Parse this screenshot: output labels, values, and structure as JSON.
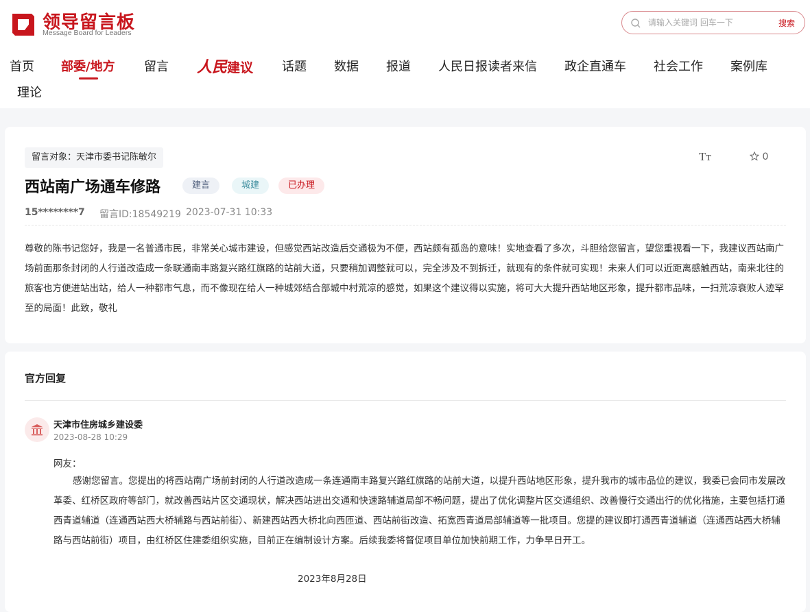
{
  "brand": {
    "title": "领导留言板",
    "subtitle": "Message Board for Leaders",
    "primary_color": "#c8161d"
  },
  "search": {
    "placeholder": "请输入关键词 回车一下",
    "button_label": "搜索",
    "icon": "search-icon"
  },
  "nav": {
    "items": [
      {
        "label": "首页"
      },
      {
        "label": "部委/地方",
        "active": true
      },
      {
        "label": "留言"
      },
      {
        "label_script": "人民",
        "label_rest": "建议"
      },
      {
        "label": "话题"
      },
      {
        "label": "数据"
      },
      {
        "label": "报道"
      },
      {
        "label": "人民日报读者来信"
      },
      {
        "label": "政企直通车"
      },
      {
        "label": "社会工作"
      },
      {
        "label": "案例库"
      },
      {
        "label": "理论"
      }
    ]
  },
  "message": {
    "target": "留言对象：天津市委书记陈敏尔",
    "font_toggle": "Tт",
    "favorite_count": "0",
    "title": "西站南广场通车修路",
    "tags": [
      "建言",
      "城建",
      "已办理"
    ],
    "user": "15********7",
    "message_id": "留言ID:18549219",
    "date": "2023-07-31 10:33",
    "content": "尊敬的陈书记您好，我是一名普通市民，非常关心城市建设，但感觉西站改造后交通极为不便，西站颇有孤岛的意味！实地查看了多次，斗胆给您留言，望您重视看一下，我建议西站南广场前面那条封闭的人行道改造成一条联通南丰路复兴路红旗路的站前大道，只要稍加调整就可以，完全涉及不到拆迁，就现有的条件就可实现！未来人们可以近距离感触西站，南来北往的旅客也方便进站出站，给人一种都市气息，而不像现在给人一种城郊结合部城中村荒凉的感觉，如果这个建议得以实施，将可大大提升西站地区形象，提升都市品味，一扫荒凉衰败人迹罕至的局面！此致，敬礼"
  },
  "reply": {
    "heading": "官方回复",
    "org_name": "天津市住房城乡建设委",
    "date": "2023-08-28 10:29",
    "salutation": "网友：",
    "body": "感谢您留言。您提出的将西站南广场前封闭的人行道改造成一条连通南丰路复兴路红旗路的站前大道，以提升西站地区形象，提升我市的城市品位的建议，我委已会同市发展改革委、红桥区政府等部门，就改善西站片区交通现状，解决西站进出交通和快速路辅道局部不畅问题，提出了优化调整片区交通组织、改善慢行交通出行的优化措施，主要包括打通西青道辅道（连通西站西大桥辅路与西站前街）、新建西站西大桥北向西匝道、西站前街改造、拓宽西青道局部辅道等一批项目。您提的建议即打通西青道辅道（连通西站西大桥辅路与西站前街）项目，由红桥区住建委组织实施，目前正在编制设计方案。后续我委将督促项目单位加快前期工作，力争早日开工。",
    "sign_date": "2023年8月28日"
  }
}
